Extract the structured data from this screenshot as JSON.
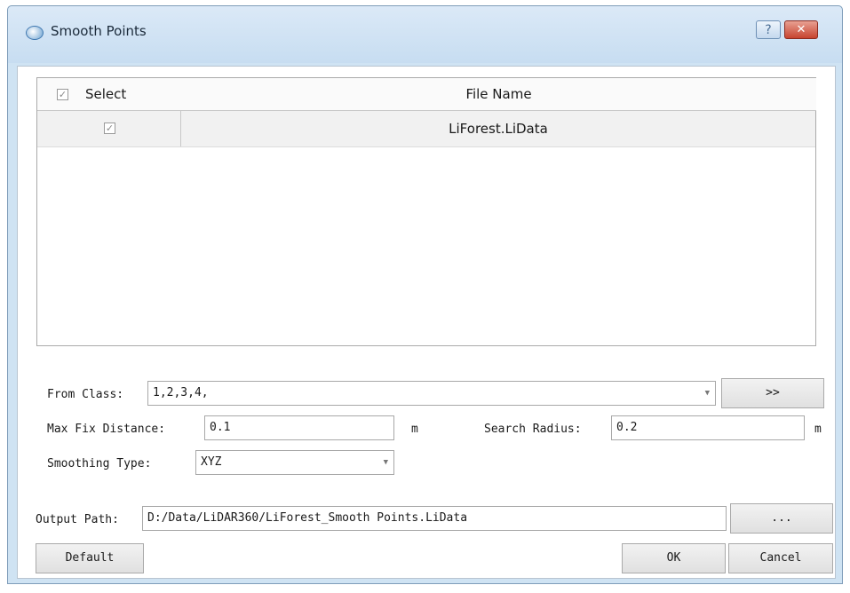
{
  "window": {
    "title": "Smooth Points",
    "help_label": "?",
    "close_label": "✕"
  },
  "table": {
    "headers": {
      "select": "Select",
      "file_name": "File Name"
    },
    "rows": [
      {
        "selected": true,
        "file_name": "LiForest.LiData"
      }
    ],
    "header_checked": true
  },
  "form": {
    "from_class": {
      "label": "From Class:",
      "value": "1,2,3,4,",
      "button": ">>"
    },
    "max_fix_distance": {
      "label": "Max Fix Distance:",
      "value": "0.1",
      "unit": "m"
    },
    "search_radius": {
      "label": "Search Radius:",
      "value": "0.2",
      "unit": "m"
    },
    "smoothing_type": {
      "label": "Smoothing Type:",
      "value": "XYZ"
    },
    "output_path": {
      "label": "Output Path:",
      "value": "D:/Data/LiDAR360/LiForest_Smooth Points.LiData",
      "browse": "..."
    }
  },
  "buttons": {
    "default": "Default",
    "ok": "OK",
    "cancel": "Cancel"
  },
  "icons": {
    "app": "app-logo-icon",
    "check": "✓",
    "dropdown": "▼"
  }
}
